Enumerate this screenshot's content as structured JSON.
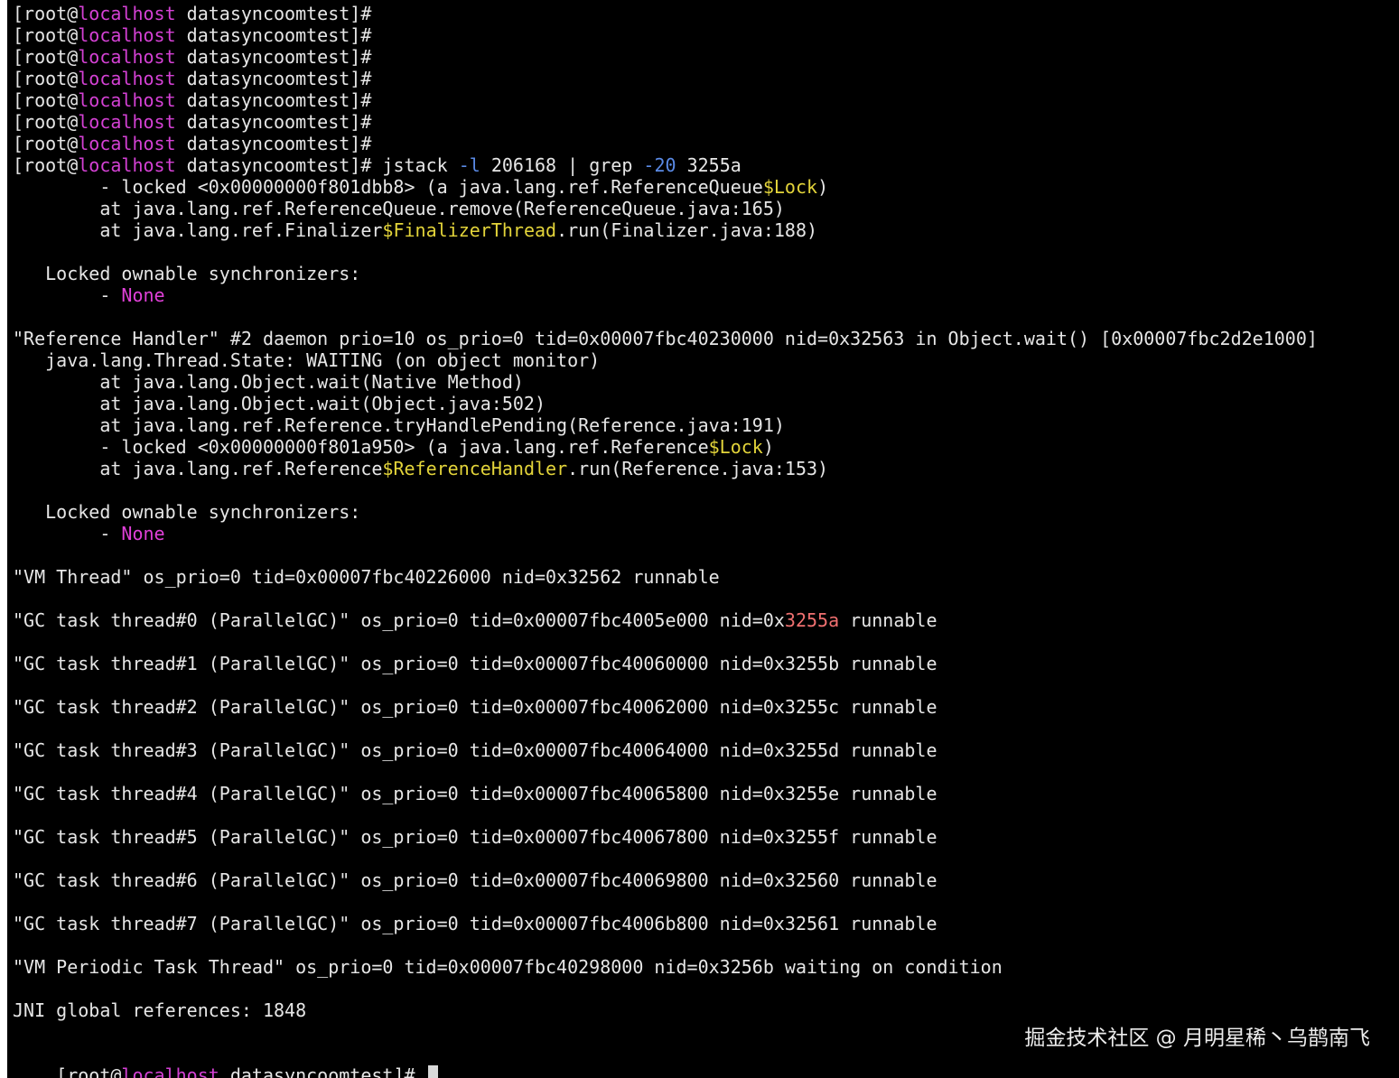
{
  "colors": {
    "background": "#000000",
    "text": "#e6e6e6",
    "host": "#d441d4",
    "flag": "#5a8ae6",
    "inner_class": "#e3d43a",
    "none": "#e040d8",
    "highlight": "#f07070"
  },
  "terminal": {
    "lines": [
      [
        {
          "t": "[root@"
        },
        {
          "t": "localhost",
          "c": "host"
        },
        {
          "t": " datasyncoomtest]#"
        }
      ],
      [
        {
          "t": "[root@"
        },
        {
          "t": "localhost",
          "c": "host"
        },
        {
          "t": " datasyncoomtest]#"
        }
      ],
      [
        {
          "t": "[root@"
        },
        {
          "t": "localhost",
          "c": "host"
        },
        {
          "t": " datasyncoomtest]#"
        }
      ],
      [
        {
          "t": "[root@"
        },
        {
          "t": "localhost",
          "c": "host"
        },
        {
          "t": " datasyncoomtest]#"
        }
      ],
      [
        {
          "t": "[root@"
        },
        {
          "t": "localhost",
          "c": "host"
        },
        {
          "t": " datasyncoomtest]#"
        }
      ],
      [
        {
          "t": "[root@"
        },
        {
          "t": "localhost",
          "c": "host"
        },
        {
          "t": " datasyncoomtest]#"
        }
      ],
      [
        {
          "t": "[root@"
        },
        {
          "t": "localhost",
          "c": "host"
        },
        {
          "t": " datasyncoomtest]#"
        }
      ],
      [
        {
          "t": "[root@"
        },
        {
          "t": "localhost",
          "c": "host"
        },
        {
          "t": " datasyncoomtest]# jstack "
        },
        {
          "t": "-l",
          "c": "flag"
        },
        {
          "t": " 206168 | grep "
        },
        {
          "t": "-20",
          "c": "flag"
        },
        {
          "t": " 3255a"
        }
      ],
      [
        {
          "t": "        - locked <0x00000000f801dbb8> (a java.lang.ref.ReferenceQueue"
        },
        {
          "t": "$Lock",
          "c": "yellow"
        },
        {
          "t": ")"
        }
      ],
      [
        {
          "t": "        at java.lang.ref.ReferenceQueue.remove(ReferenceQueue.java:165)"
        }
      ],
      [
        {
          "t": "        at java.lang.ref.Finalizer"
        },
        {
          "t": "$FinalizerThread",
          "c": "yellow"
        },
        {
          "t": ".run(Finalizer.java:188)"
        }
      ],
      [],
      [
        {
          "t": "   Locked ownable synchronizers:"
        }
      ],
      [
        {
          "t": "        - "
        },
        {
          "t": "None",
          "c": "none"
        }
      ],
      [],
      [
        {
          "t": "\"Reference Handler\" #2 daemon prio=10 os_prio=0 tid=0x00007fbc40230000 nid=0x32563 in Object.wait() [0x00007fbc2d2e1000]"
        }
      ],
      [
        {
          "t": "   java.lang.Thread.State: WAITING (on object monitor)"
        }
      ],
      [
        {
          "t": "        at java.lang.Object.wait(Native Method)"
        }
      ],
      [
        {
          "t": "        at java.lang.Object.wait(Object.java:502)"
        }
      ],
      [
        {
          "t": "        at java.lang.ref.Reference.tryHandlePending(Reference.java:191)"
        }
      ],
      [
        {
          "t": "        - locked <0x00000000f801a950> (a java.lang.ref.Reference"
        },
        {
          "t": "$Lock",
          "c": "yellow"
        },
        {
          "t": ")"
        }
      ],
      [
        {
          "t": "        at java.lang.ref.Reference"
        },
        {
          "t": "$ReferenceHandler",
          "c": "yellow"
        },
        {
          "t": ".run(Reference.java:153)"
        }
      ],
      [],
      [
        {
          "t": "   Locked ownable synchronizers:"
        }
      ],
      [
        {
          "t": "        - "
        },
        {
          "t": "None",
          "c": "none"
        }
      ],
      [],
      [
        {
          "t": "\"VM Thread\" os_prio=0 tid=0x00007fbc40226000 nid=0x32562 runnable"
        }
      ],
      [],
      [
        {
          "t": "\"GC task thread#0 (ParallelGC)\" os_prio=0 tid=0x00007fbc4005e000 nid=0x"
        },
        {
          "t": "3255a",
          "c": "hl"
        },
        {
          "t": " runnable"
        }
      ],
      [],
      [
        {
          "t": "\"GC task thread#1 (ParallelGC)\" os_prio=0 tid=0x00007fbc40060000 nid=0x3255b runnable"
        }
      ],
      [],
      [
        {
          "t": "\"GC task thread#2 (ParallelGC)\" os_prio=0 tid=0x00007fbc40062000 nid=0x3255c runnable"
        }
      ],
      [],
      [
        {
          "t": "\"GC task thread#3 (ParallelGC)\" os_prio=0 tid=0x00007fbc40064000 nid=0x3255d runnable"
        }
      ],
      [],
      [
        {
          "t": "\"GC task thread#4 (ParallelGC)\" os_prio=0 tid=0x00007fbc40065800 nid=0x3255e runnable"
        }
      ],
      [],
      [
        {
          "t": "\"GC task thread#5 (ParallelGC)\" os_prio=0 tid=0x00007fbc40067800 nid=0x3255f runnable"
        }
      ],
      [],
      [
        {
          "t": "\"GC task thread#6 (ParallelGC)\" os_prio=0 tid=0x00007fbc40069800 nid=0x32560 runnable"
        }
      ],
      [],
      [
        {
          "t": "\"GC task thread#7 (ParallelGC)\" os_prio=0 tid=0x00007fbc4006b800 nid=0x32561 runnable"
        }
      ],
      [],
      [
        {
          "t": "\"VM Periodic Task Thread\" os_prio=0 tid=0x00007fbc40298000 nid=0x3256b waiting on condition"
        }
      ],
      [],
      [
        {
          "t": "JNI global references: 1848"
        }
      ],
      []
    ],
    "prompt": {
      "before_host": "[root@",
      "host": "localhost",
      "after_host": " datasyncoomtest]# "
    }
  },
  "watermark": "掘金技术社区 @ 月明星稀丶乌鹊南飞"
}
